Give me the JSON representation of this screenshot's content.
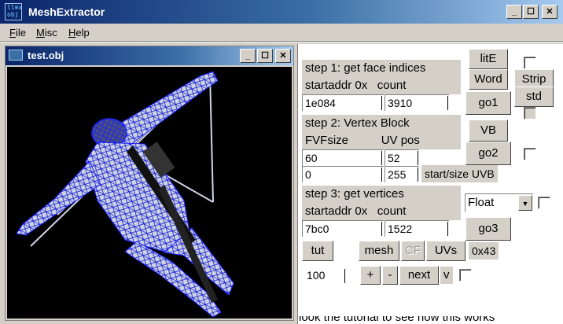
{
  "window": {
    "title": "MeshExtractor",
    "icon_text_1": "ll⊗x",
    "icon_text_2": "obj",
    "minimize": "_",
    "maximize": "☐",
    "close": "✕"
  },
  "menu": {
    "file_u": "F",
    "file_rest": "ile",
    "misc_u": "M",
    "misc_rest": "isc",
    "help_u": "H",
    "help_rest": "elp"
  },
  "child": {
    "title": "test.obj"
  },
  "panel": {
    "step1": {
      "title": "step 1: get face indices",
      "addr_label": "startaddr 0x",
      "count_label": "count",
      "addr_value": "1e084",
      "count_value": "3910"
    },
    "step2": {
      "title": "step 2: Vertex Block",
      "fvf_label": "FVFsize",
      "uv_label": "UV pos",
      "fvf_value": "60",
      "uv_value": "52",
      "start_value": "0",
      "size_value": "255",
      "start_size_label": "start/size UVB"
    },
    "step3": {
      "title": "step 3: get vertices",
      "addr_label": "startaddr 0x",
      "count_label": "count",
      "addr_value": "7bc0",
      "count_value": "1522"
    },
    "buttons": {
      "lite": "litE",
      "word": "Word",
      "strip": "Strip",
      "std": "std",
      "go1": "go1",
      "vb": "VB",
      "go2": "go2",
      "go3": "go3",
      "tut": "tut",
      "mesh": "mesh",
      "cf": "CF",
      "uvs": "UVs",
      "plus": "+",
      "minus": "-",
      "next": "next",
      "v": "v"
    },
    "format_select": "Float",
    "hex_label": "0x43",
    "step_value": "100",
    "status_partial": "look the tutorial to see how this works"
  }
}
